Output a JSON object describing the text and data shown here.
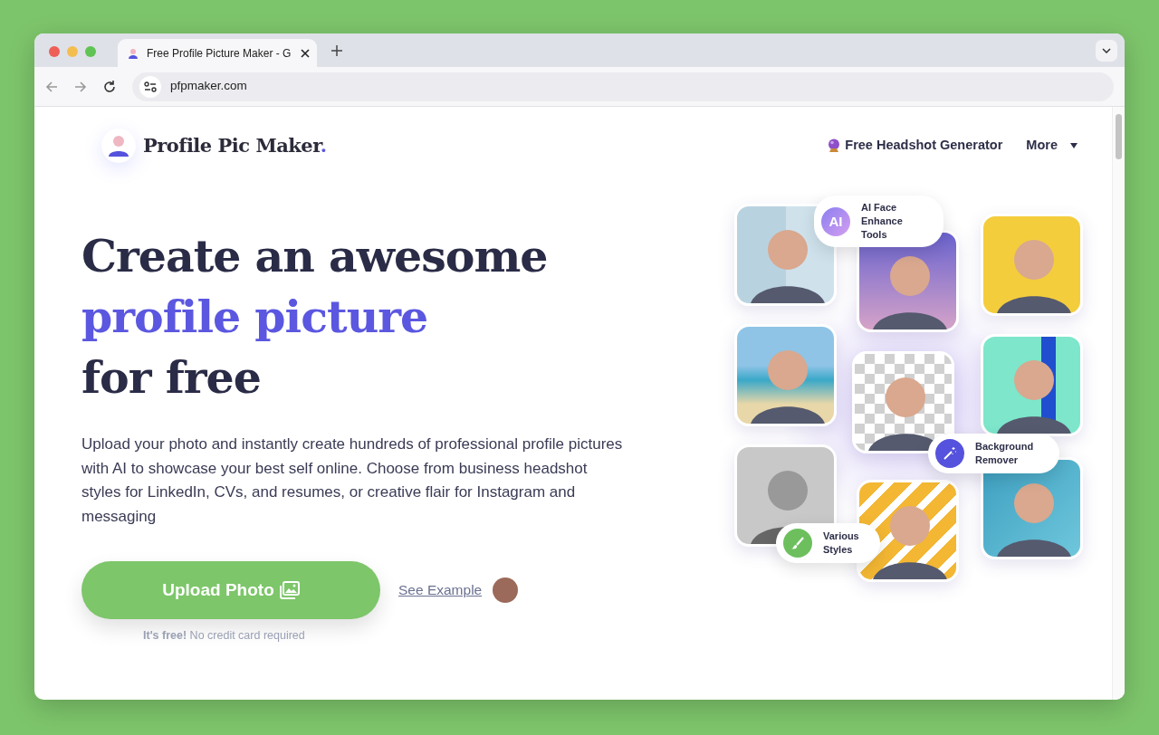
{
  "browser": {
    "tab_title": "Free Profile Picture Maker - G",
    "url": "pfpmaker.com"
  },
  "header": {
    "logo": {
      "text": "Profile Pic Maker",
      "accent": "."
    },
    "nav": [
      {
        "kind": "crystal",
        "label": "Free Headshot Generator"
      },
      {
        "kind": "dropdown",
        "label": "More"
      }
    ]
  },
  "hero": {
    "headline": [
      {
        "text": "Create an awesome",
        "accent": false
      },
      {
        "text": "profile picture",
        "accent": true
      },
      {
        "text": "for free",
        "accent": false
      }
    ],
    "description": "Upload your photo and instantly create hundreds of professional profile pictures with AI to showcase your best self online. Choose from business headshot styles for LinkedIn, CVs, and resumes, or creative flair for Instagram and messaging",
    "primary_button": "Upload Photo",
    "example_link": "See Example",
    "note": "**It's free!** No credit card required"
  },
  "collage": {
    "photos": [
      {
        "kind": "split"
      },
      {
        "kind": "beach"
      },
      {
        "kind": "mono"
      },
      {
        "kind": "purple"
      },
      {
        "kind": "transparent"
      },
      {
        "kind": "pattern"
      },
      {
        "kind": "glitch"
      },
      {
        "kind": "teal"
      },
      {
        "kind": "blue"
      }
    ],
    "badges": [
      {
        "kind": "ai",
        "icon_text": "AI",
        "text": "AI Face Enhance Tools"
      },
      {
        "kind": "wand",
        "text": "Background Remover"
      },
      {
        "kind": "brush",
        "text": "Various Styles"
      }
    ]
  }
}
